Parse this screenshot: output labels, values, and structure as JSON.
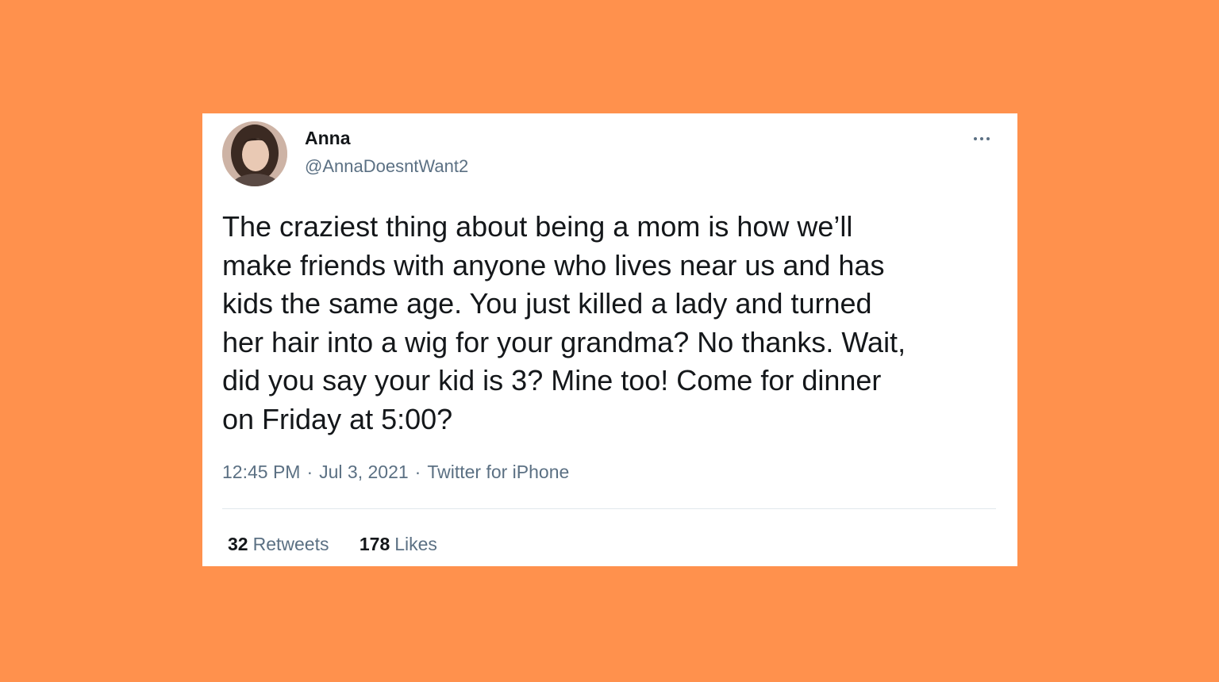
{
  "colors": {
    "background": "#FF914D",
    "card": "#FFFFFF",
    "text_primary": "#14171A",
    "text_secondary": "#5B7083"
  },
  "tweet": {
    "author": {
      "display_name": "Anna",
      "handle": "@AnnaDoesntWant2",
      "avatar_icon": "profile-photo"
    },
    "more_icon": "more-horizontal-icon",
    "text": "The craziest thing about being a mom is how we’ll\nmake friends with anyone who lives near us and has\nkids the same age. You just killed a lady and turned\nher hair into a wig for your grandma? No thanks. Wait,\ndid you say your kid is 3? Mine too! Come for dinner\non Friday at 5:00?",
    "time": "12:45 PM",
    "date": "Jul 3, 2021",
    "source": "Twitter for iPhone",
    "separator": "·",
    "stats": {
      "retweets_count": "32",
      "retweets_label": "Retweets",
      "likes_count": "178",
      "likes_label": "Likes"
    }
  }
}
